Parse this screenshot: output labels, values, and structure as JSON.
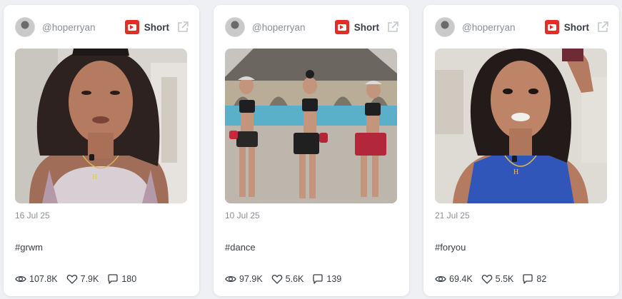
{
  "cards": [
    {
      "handle": "@hoperryan",
      "badge": "Short",
      "date": "16 Jul 25",
      "caption": "#grwm",
      "views": "107.8K",
      "likes": "7.9K",
      "comments": "180"
    },
    {
      "handle": "@hoperryan",
      "badge": "Short",
      "date": "10 Jul 25",
      "caption": "#dance",
      "views": "97.9K",
      "likes": "5.6K",
      "comments": "139"
    },
    {
      "handle": "@hoperryan",
      "badge": "Short",
      "date": "21 Jul 25",
      "caption": "#foryou",
      "views": "69.4K",
      "likes": "5.5K",
      "comments": "82"
    }
  ],
  "icons": {
    "platform": "youtube-icon",
    "external": "external-link-icon",
    "views": "eye-icon",
    "likes": "heart-icon",
    "comments": "comment-icon"
  },
  "colors": {
    "youtube_red": "#e52d27",
    "muted_text": "#8a8f98",
    "body_text": "#3a3f47",
    "card_bg": "#ffffff",
    "page_bg": "#eef0f3"
  }
}
